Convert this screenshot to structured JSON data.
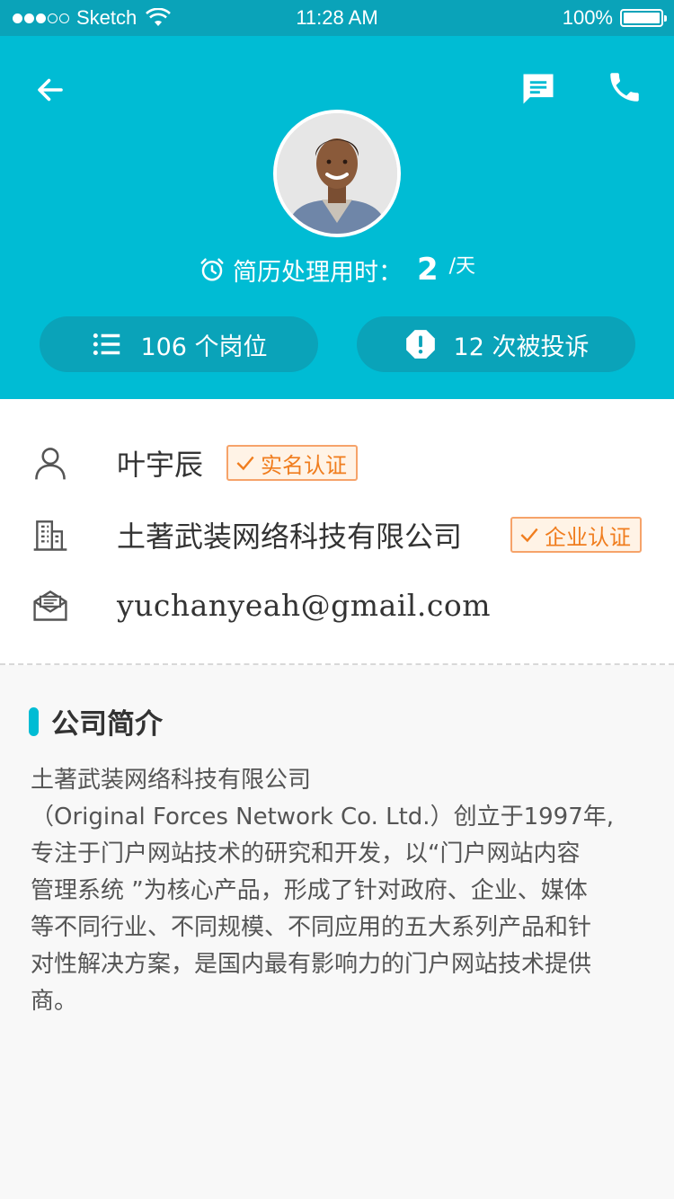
{
  "status_bar": {
    "carrier": "Sketch",
    "time": "11:28 AM",
    "battery": "100%"
  },
  "header": {
    "response_label": "简历处理用时：",
    "response_value": "2",
    "response_unit": "/天",
    "jobs_label": "106 个岗位",
    "complaints_label": "12 次被投诉"
  },
  "profile": {
    "name": "叶宇辰",
    "name_badge": "实名认证",
    "company": "土著武装网络科技有限公司",
    "company_badge": "企业认证",
    "email": "yuchanyeah@gmail.com"
  },
  "section": {
    "title": "公司简介",
    "description": "土著武装网络科技有限公司\n（Original Forces Network Co. Ltd.）创立于1997年,\n专注于门户网站技术的研究和开发，以“门户网站内容\n管理系统 ”为核心产品，形成了针对政府、企业、媒体\n等不同行业、不同规模、不同应用的五大系列产品和针\n对性解决方案，是国内最有影响力的门户网站技术提供\n商。"
  },
  "colors": {
    "primary": "#00bcd4",
    "primary_dark": "#0aa3b9",
    "badge_orange": "#f07d1e"
  }
}
